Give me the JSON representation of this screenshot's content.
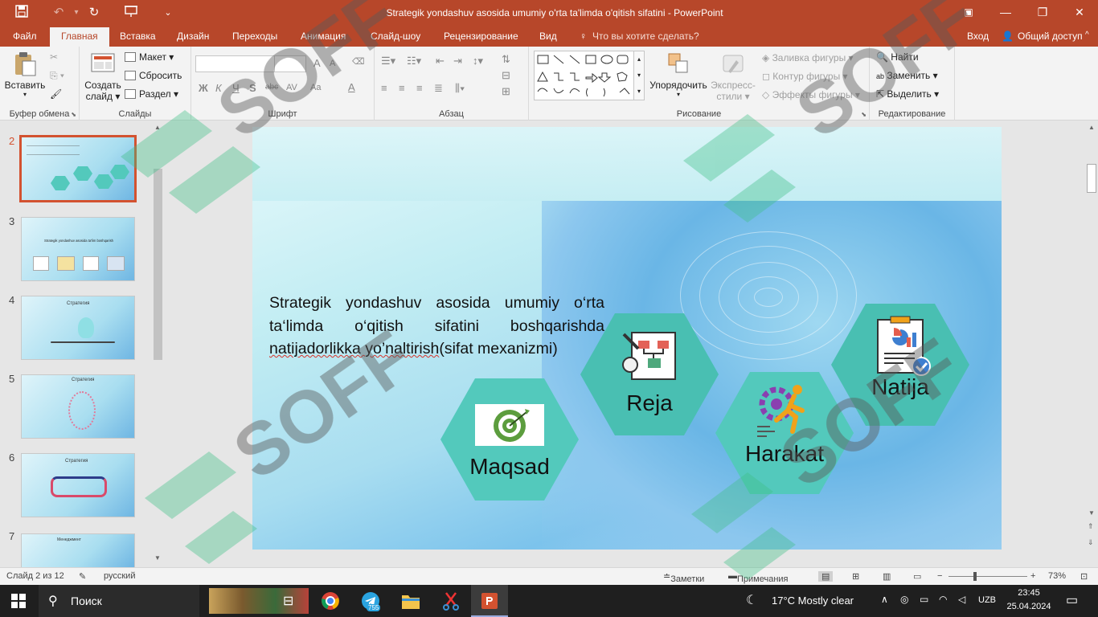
{
  "window": {
    "title": "Strategik yondashuv asosida umumiy o'rta ta'limda o'qitish sifatini - PowerPoint",
    "controls": {
      "minimize": "—",
      "restore": "❐",
      "close": "✕"
    }
  },
  "ribbon_tabs": {
    "items": [
      "Файл",
      "Главная",
      "Вставка",
      "Дизайн",
      "Переходы",
      "Анимация",
      "Слайд-шоу",
      "Рецензирование",
      "Вид"
    ],
    "active": "Главная",
    "tell_me": "Что вы хотите сделать?",
    "signin": "Вход",
    "share": "Общий доступ"
  },
  "ribbon": {
    "clipboard": {
      "paste": "Вставить",
      "label": "Буфер обмена"
    },
    "slides": {
      "new_slide_line1": "Создать",
      "new_slide_line2": "слайд",
      "layout": "Макет",
      "reset": "Сбросить",
      "section": "Раздел",
      "label": "Слайды"
    },
    "font": {
      "bold": "Ж",
      "italic": "К",
      "underline": "Ч",
      "shadow": "S",
      "strike": "abc",
      "spacing": "AV",
      "case": "Aa",
      "color": "A",
      "grow": "A",
      "shrink": "A",
      "label": "Шрифт"
    },
    "paragraph": {
      "label": "Абзац"
    },
    "drawing": {
      "arrange": "Упорядочить",
      "quick_styles_line1": "Экспресс-",
      "quick_styles_line2": "стили",
      "fill": "Заливка фигуры",
      "outline": "Контур фигуры",
      "effects": "Эффекты фигуры",
      "label": "Рисование"
    },
    "editing": {
      "find": "Найти",
      "replace": "Заменить",
      "select": "Выделить",
      "label": "Редактирование"
    }
  },
  "thumbnails": {
    "numbers": [
      "2",
      "3",
      "4",
      "5",
      "6",
      "7"
    ],
    "selected": "2",
    "t3_title": "Strategik yondashuv asosida ta'lim boshqarish",
    "t4_title": "Стратегия",
    "t5_title": "Стратегия",
    "t6_title": "Стратегия",
    "t7_title": "Менеджмент"
  },
  "slide": {
    "text_part1": "Strategik yondashuv asosida umumiy o‘rta ta‘limda o‘qitish sifatini boshqarishda",
    "text_part2": "natijadorlikka yo’naltirish",
    "text_part3": "(sifat mexanizmi)",
    "hexagons": {
      "maqsad": "Maqsad",
      "reja": "Reja",
      "harakat": "Harakat",
      "natija": "Natija"
    }
  },
  "status": {
    "slide_info": "Слайд 2 из 12",
    "language": "русский",
    "notes": "Заметки",
    "comments": "Примечания",
    "zoom": "73%"
  },
  "taskbar": {
    "search": "Поиск",
    "weather": "17°C  Mostly clear",
    "language": "UZB",
    "time": "23:45",
    "date": "25.04.2024",
    "telegram_badge": "755"
  },
  "watermark": {
    "text": "SOFF"
  },
  "colors": {
    "powerpoint": "#b7472a",
    "hexagon": "#53c9bc",
    "accent_selection": "#d35230"
  }
}
